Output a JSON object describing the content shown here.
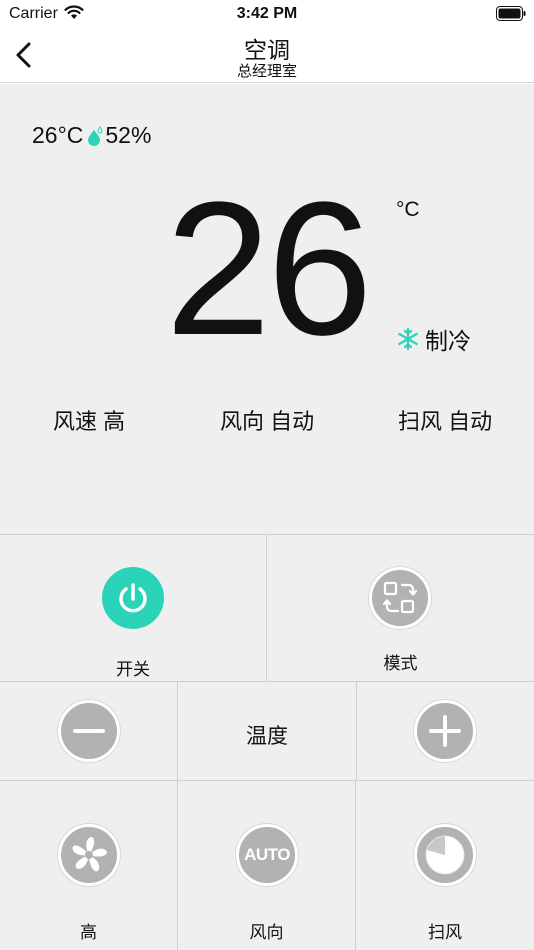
{
  "status_bar": {
    "carrier": "Carrier",
    "time": "3:42 PM"
  },
  "nav": {
    "title": "空调",
    "subtitle": "总经理室"
  },
  "display": {
    "room_temp": "26°C",
    "humidity": "52%",
    "set_temp": "26",
    "unit": "°C",
    "mode": "制冷",
    "fan_speed": "风速 高",
    "fan_direction": "风向 自动",
    "swing": "扫风 自动"
  },
  "controls": {
    "power_label": "开关",
    "mode_label": "模式",
    "temp_label": "温度",
    "speed_label": "高",
    "direction_label": "风向",
    "direction_icon_text": "AUTO",
    "swing_label": "扫风"
  },
  "colors": {
    "accent": "#2bd3b8",
    "button_gray": "#b2b2b2",
    "panel_bg": "#efefef"
  },
  "icons": [
    "back-chevron-icon",
    "wifi-icon",
    "battery-icon",
    "humidity-drop-icon",
    "snowflake-icon",
    "power-icon",
    "mode-switch-icon",
    "minus-icon",
    "plus-icon",
    "fan-icon",
    "swing-icon"
  ]
}
